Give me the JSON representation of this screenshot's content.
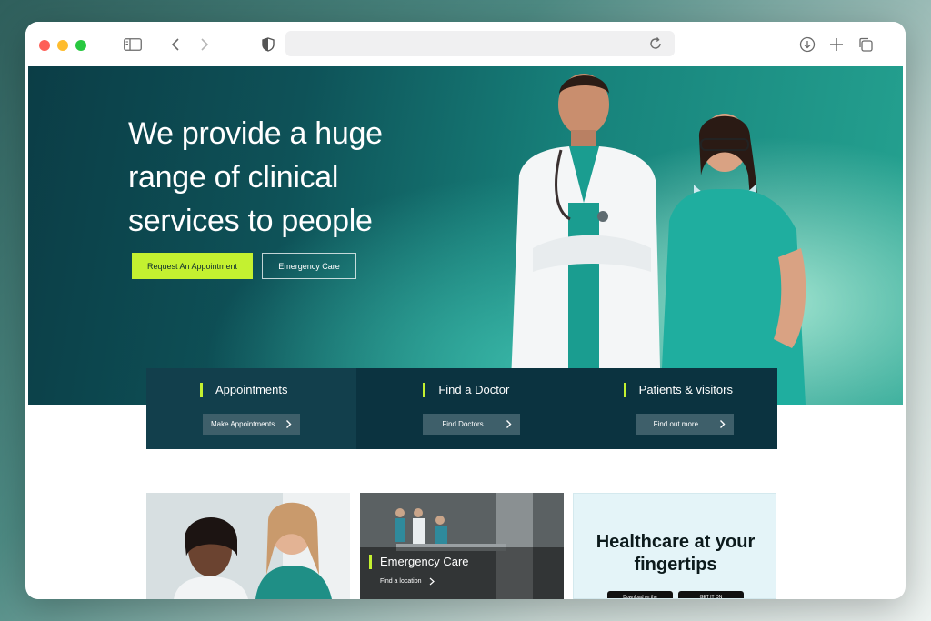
{
  "browser": {
    "url": ""
  },
  "hero": {
    "title": "We provide a huge range of clinical services to people",
    "primary_cta": "Request An Appointment",
    "secondary_cta": "Emergency Care"
  },
  "services": [
    {
      "title": "Appointments",
      "button": "Make Appointments"
    },
    {
      "title": "Find a Doctor",
      "button": "Find Doctors"
    },
    {
      "title": "Patients & visitors",
      "button": "Find out more"
    }
  ],
  "cards": {
    "emergency": {
      "title": "Emergency Care",
      "link": "Find a location"
    },
    "app": {
      "title": "Healthcare at your fingertips",
      "badges": [
        "Download on the",
        "GET IT ON"
      ]
    }
  },
  "colors": {
    "accent": "#c4f130",
    "dark_teal": "#0b3340",
    "hero_teal": "#17827b"
  }
}
